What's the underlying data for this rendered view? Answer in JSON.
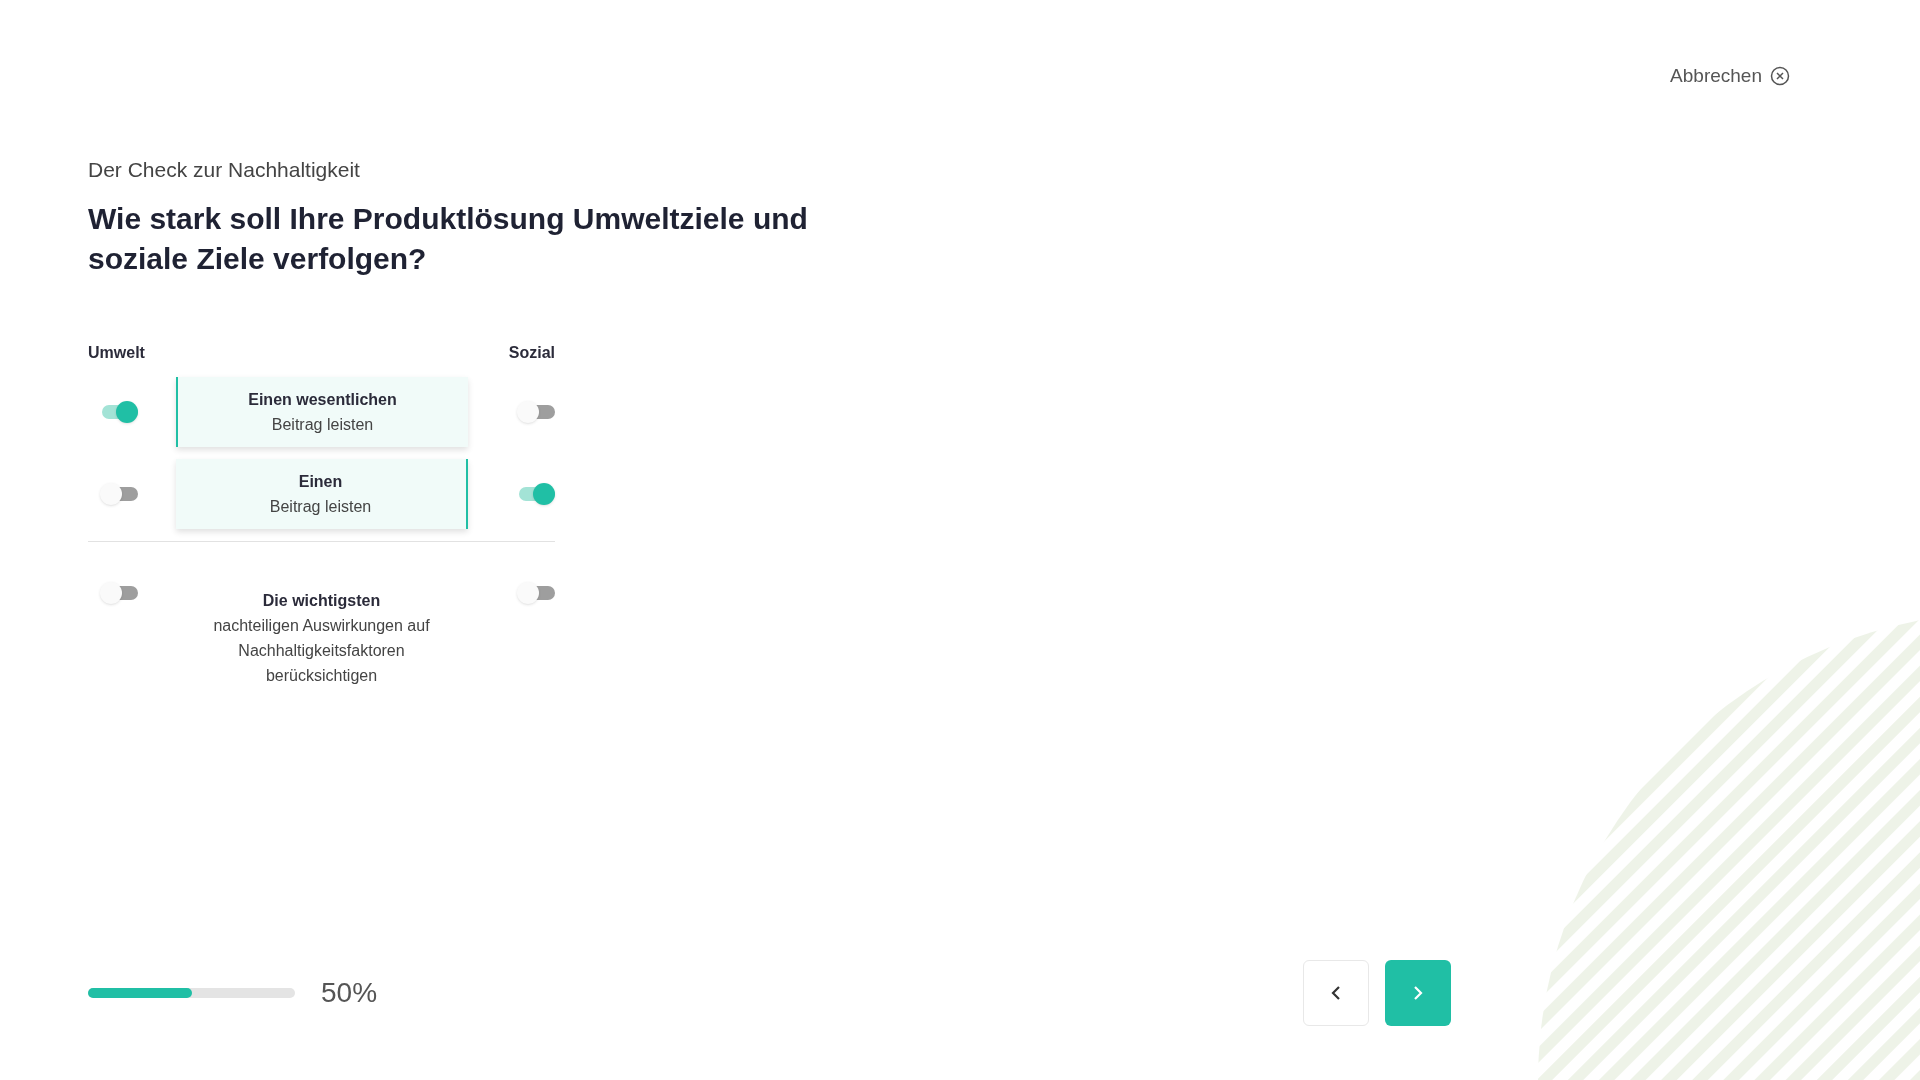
{
  "cancel": {
    "label": "Abbrechen"
  },
  "subtitle": "Der Check zur Nachhaltigkeit",
  "question": "Wie stark soll Ihre Produktlösung Umweltziele und soziale Ziele verfolgen?",
  "columns": {
    "left": "Umwelt",
    "right": "Sozial"
  },
  "options": [
    {
      "title": "Einen wesentlichen",
      "text": "Beitrag leisten",
      "umwelt_on": true,
      "sozial_on": false
    },
    {
      "title": "Einen",
      "text": "Beitrag leisten",
      "umwelt_on": false,
      "sozial_on": true
    },
    {
      "title": "Die wichtigsten",
      "text": "nachteiligen Auswirkungen auf Nachhaltigkeitsfaktoren berücksichtigen",
      "umwelt_on": false,
      "sozial_on": false
    }
  ],
  "progress": {
    "level": 0.5,
    "reading": "50%"
  }
}
